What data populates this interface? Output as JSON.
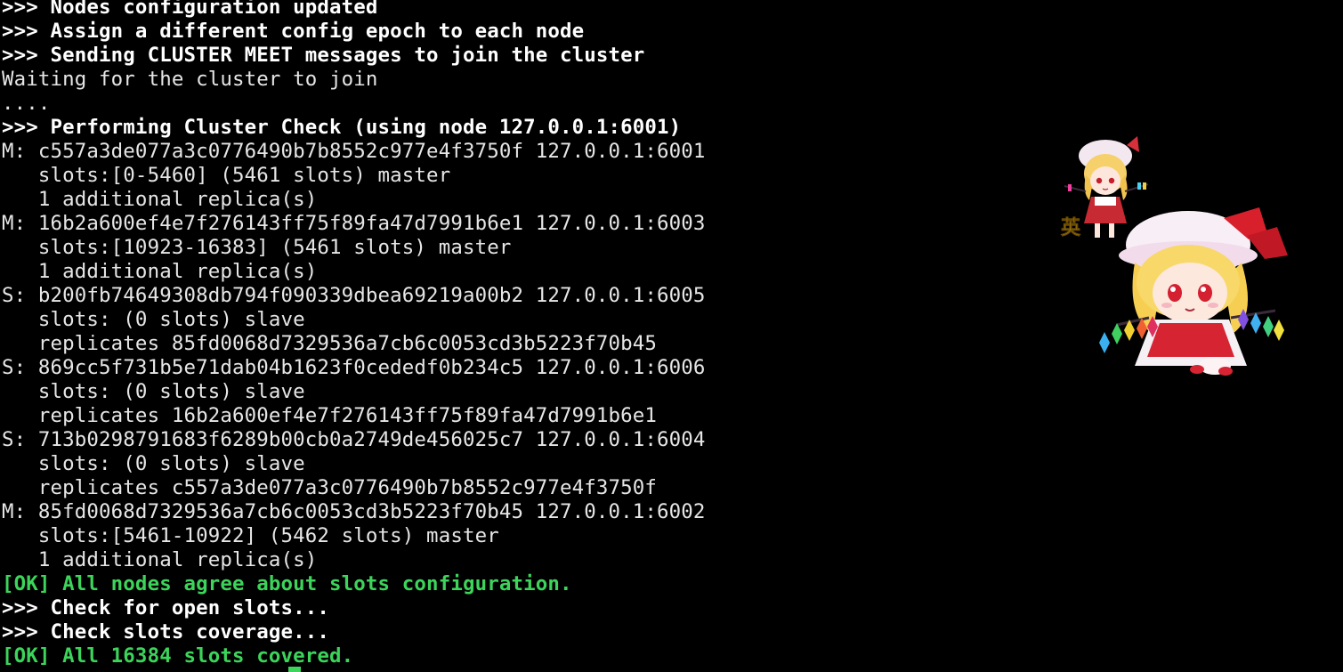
{
  "terminal": {
    "lines": [
      {
        "text": ">>> Nodes configuration updated",
        "style": "bold"
      },
      {
        "text": ">>> Assign a different config epoch to each node",
        "style": "bold"
      },
      {
        "text": ">>> Sending CLUSTER MEET messages to join the cluster",
        "style": "bold"
      },
      {
        "text": "Waiting for the cluster to join",
        "style": "normal"
      },
      {
        "text": "....",
        "style": "normal"
      },
      {
        "text": ">>> Performing Cluster Check (using node 127.0.0.1:6001)",
        "style": "bold"
      },
      {
        "text": "M: c557a3de077a3c0776490b7b8552c977e4f3750f 127.0.0.1:6001",
        "style": "normal"
      },
      {
        "text": "   slots:[0-5460] (5461 slots) master",
        "style": "normal"
      },
      {
        "text": "   1 additional replica(s)",
        "style": "normal"
      },
      {
        "text": "M: 16b2a600ef4e7f276143ff75f89fa47d7991b6e1 127.0.0.1:6003",
        "style": "normal"
      },
      {
        "text": "   slots:[10923-16383] (5461 slots) master",
        "style": "normal"
      },
      {
        "text": "   1 additional replica(s)",
        "style": "normal"
      },
      {
        "text": "S: b200fb74649308db794f090339dbea69219a00b2 127.0.0.1:6005",
        "style": "normal"
      },
      {
        "text": "   slots: (0 slots) slave",
        "style": "normal"
      },
      {
        "text": "   replicates 85fd0068d7329536a7cb6c0053cd3b5223f70b45",
        "style": "normal"
      },
      {
        "text": "S: 869cc5f731b5e71dab04b1623f0cededf0b234c5 127.0.0.1:6006",
        "style": "normal"
      },
      {
        "text": "   slots: (0 slots) slave",
        "style": "normal"
      },
      {
        "text": "   replicates 16b2a600ef4e7f276143ff75f89fa47d7991b6e1",
        "style": "normal"
      },
      {
        "text": "S: 713b0298791683f6289b00cb0a2749de456025c7 127.0.0.1:6004",
        "style": "normal"
      },
      {
        "text": "   slots: (0 slots) slave",
        "style": "normal"
      },
      {
        "text": "   replicates c557a3de077a3c0776490b7b8552c977e4f3750f",
        "style": "normal"
      },
      {
        "text": "M: 85fd0068d7329536a7cb6c0053cd3b5223f70b45 127.0.0.1:6002",
        "style": "normal"
      },
      {
        "text": "   slots:[5461-10922] (5462 slots) master",
        "style": "normal"
      },
      {
        "text": "   1 additional replica(s)",
        "style": "normal"
      },
      {
        "text": "[OK] All nodes agree about slots configuration.",
        "style": "ok"
      },
      {
        "text": ">>> Check for open slots...",
        "style": "bold"
      },
      {
        "text": ">>> Check slots coverage...",
        "style": "bold"
      },
      {
        "text": "[OK] All 16384 slots covered.",
        "style": "ok"
      }
    ]
  },
  "colors": {
    "background": "#000000",
    "text": "#e6e6e6",
    "bold_text": "#ffffff",
    "ok_text": "#3cd45a",
    "cursor": "#3cd45a"
  },
  "decorations": {
    "mascot_small_label": "英",
    "mascot_small_icon": "chibi-character-small-icon",
    "mascot_big_icon": "chibi-character-large-icon"
  }
}
